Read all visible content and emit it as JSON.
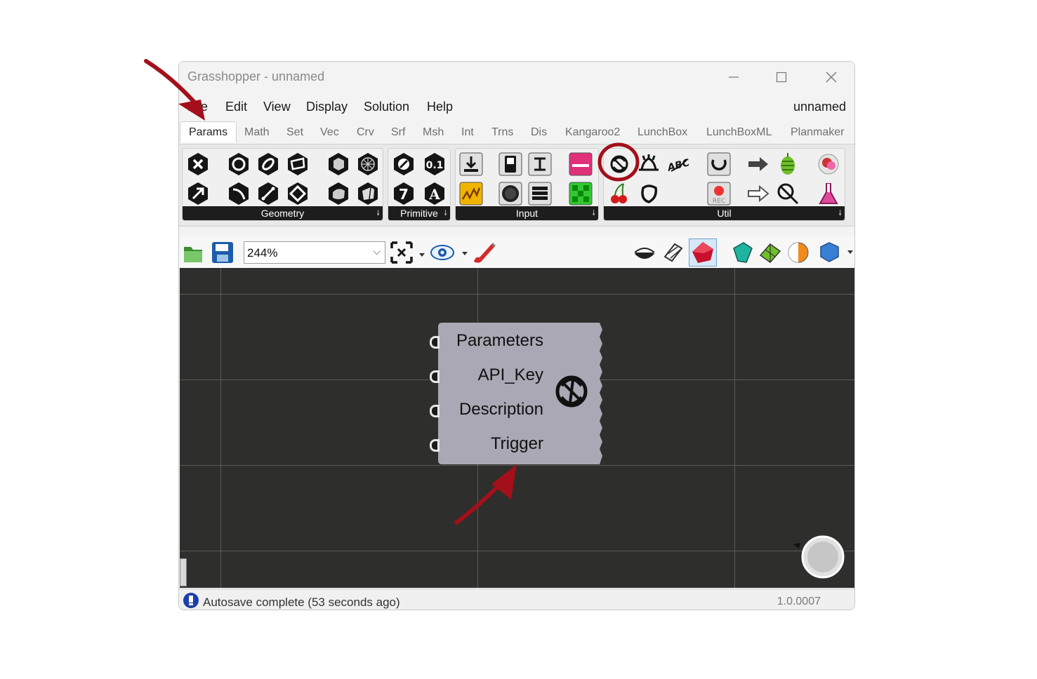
{
  "window": {
    "title": "Grasshopper - unnamed",
    "document_name": "unnamed"
  },
  "menu": {
    "items": [
      {
        "label": "File"
      },
      {
        "label": "Edit"
      },
      {
        "label": "View"
      },
      {
        "label": "Display"
      },
      {
        "label": "Solution"
      },
      {
        "label": "Help"
      }
    ]
  },
  "tabs": [
    {
      "label": "Params",
      "active": true
    },
    {
      "label": "Math"
    },
    {
      "label": "Set"
    },
    {
      "label": "Vec"
    },
    {
      "label": "Crv"
    },
    {
      "label": "Srf"
    },
    {
      "label": "Msh"
    },
    {
      "label": "Int"
    },
    {
      "label": "Trns"
    },
    {
      "label": "Dis"
    },
    {
      "label": "Kangaroo2"
    },
    {
      "label": "LunchBox"
    },
    {
      "label": "LunchBoxML"
    },
    {
      "label": "Planmaker"
    }
  ],
  "ribbon": {
    "panels": [
      {
        "label": "Geometry"
      },
      {
        "label": "Primitive"
      },
      {
        "label": "Input"
      },
      {
        "label": "Util"
      }
    ]
  },
  "toolbar": {
    "zoom": "244%"
  },
  "component": {
    "inputs": [
      {
        "label": "Parameters"
      },
      {
        "label": "API_Key"
      },
      {
        "label": "Description"
      },
      {
        "label": "Trigger"
      }
    ]
  },
  "status": {
    "message": "Autosave complete (53 seconds ago)",
    "version": "1.0.0007"
  },
  "colors": {
    "canvas": "#2e2e2c",
    "grid": "#5b5b56",
    "component": "#a9a8b4",
    "annotation": "#a30f1a"
  }
}
